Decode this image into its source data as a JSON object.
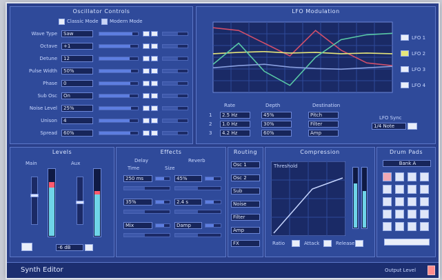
{
  "window": {
    "title": "Synth Editor"
  },
  "osc": {
    "title": "Oscillator Controls",
    "mode_a": "Classic Mode",
    "mode_b": "Modern Mode",
    "rows": [
      {
        "label": "Wave Type",
        "value": "Saw",
        "fill": 0.85
      },
      {
        "label": "Octave",
        "value": "+1",
        "fill": 0.8
      },
      {
        "label": "Detune",
        "value": "12",
        "fill": 0.78
      },
      {
        "label": "Pulse Width",
        "value": "50%",
        "fill": 0.82
      },
      {
        "label": "Phase",
        "value": "0",
        "fill": 0.8
      },
      {
        "label": "Sub Osc",
        "value": "On",
        "fill": 0.79
      },
      {
        "label": "Noise Level",
        "value": "25%",
        "fill": 0.83
      },
      {
        "label": "Unison",
        "value": "4",
        "fill": 0.78
      },
      {
        "label": "Spread",
        "value": "60%",
        "fill": 0.81
      }
    ]
  },
  "lfo": {
    "title": "LFO Modulation",
    "legend": [
      {
        "name": "LFO 1",
        "color": "#d04f6a"
      },
      {
        "name": "LFO 2",
        "color": "#e6e67a"
      },
      {
        "name": "LFO 3",
        "color": "#59c9a6"
      },
      {
        "name": "LFO 4",
        "color": "#8aa0e0"
      }
    ],
    "table_headers": [
      "Rate",
      "Depth",
      "Destination"
    ],
    "table_rows": [
      {
        "label": "1",
        "values": [
          "2.5 Hz",
          "45%",
          "Pitch"
        ]
      },
      {
        "label": "2",
        "values": [
          "1.0 Hz",
          "30%",
          "Filter"
        ]
      },
      {
        "label": "3",
        "values": [
          "4.2 Hz",
          "60%",
          "Amp"
        ]
      }
    ],
    "sync_label": "LFO Sync",
    "sync_value": "1/4 Note",
    "chart_data": {
      "type": "line",
      "x": [
        0,
        1,
        2,
        3,
        4,
        5,
        6,
        7
      ],
      "ylim": [
        0,
        100
      ],
      "series": [
        {
          "name": "LFO 1",
          "color": "#d04f6a",
          "values": [
            92,
            88,
            70,
            52,
            88,
            60,
            42,
            38
          ]
        },
        {
          "name": "LFO 2",
          "color": "#e6e67a",
          "values": [
            55,
            57,
            58,
            56,
            57,
            55,
            56,
            55
          ]
        },
        {
          "name": "LFO 3",
          "color": "#59c9a6",
          "values": [
            40,
            70,
            30,
            10,
            50,
            75,
            82,
            84
          ]
        },
        {
          "name": "LFO 4",
          "color": "#8aa0e0",
          "values": [
            35,
            38,
            40,
            36,
            34,
            33,
            35,
            37
          ]
        }
      ]
    }
  },
  "levels": {
    "title": "Levels",
    "left_label": "Main",
    "right_label": "Aux",
    "left_level": 0.82,
    "right_level": 0.68,
    "bottom_value": "-6 dB"
  },
  "fx": {
    "title": "Effects",
    "col_a": "Delay",
    "col_b": "Reverb",
    "sub_a": "Time",
    "sub_b": "Size",
    "rows": [
      {
        "a": "250 ms",
        "b": "45%"
      },
      {
        "a": "35%",
        "b": "2.4 s"
      },
      {
        "a": "Mix",
        "b": "Damp"
      }
    ]
  },
  "routing": {
    "title": "Routing",
    "items": [
      "Osc 1",
      "Osc 2",
      "Sub",
      "Noise",
      "Filter",
      "Amp",
      "FX"
    ]
  },
  "comp": {
    "title": "Compression",
    "threshold": "Threshold",
    "controls": [
      "Ratio",
      "Attack",
      "Release"
    ],
    "meter_left": 0.75,
    "meter_right": 0.62
  },
  "pads": {
    "title": "Drum Pads",
    "bank": "Bank A",
    "grid_active": [
      0
    ]
  },
  "footer": {
    "status": "Output Level"
  }
}
